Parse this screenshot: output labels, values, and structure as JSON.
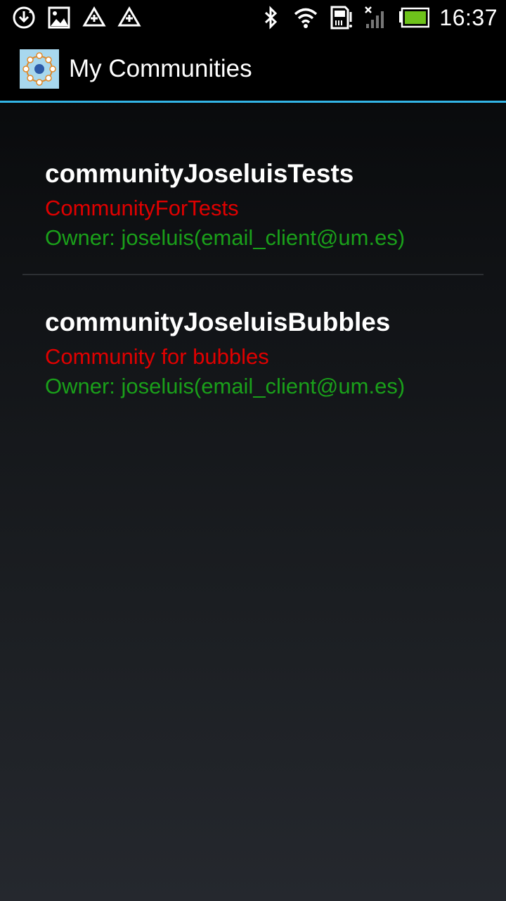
{
  "status_bar": {
    "time": "16:37",
    "left_icons": [
      "sync-download-icon",
      "gallery-icon",
      "recycle-icon",
      "recycle-icon"
    ],
    "right_icons": [
      "bluetooth-icon",
      "wifi-icon",
      "sd-card-alert-icon",
      "signal-off-icon",
      "battery-icon"
    ]
  },
  "action_bar": {
    "title": "My Communities",
    "accent_color": "#33b5e5"
  },
  "communities": [
    {
      "name": "communityJoseluisTests",
      "description": "CommunityForTests",
      "owner": "Owner: joseluis(email_client@um.es)"
    },
    {
      "name": "communityJoseluisBubbles",
      "description": "Community for bubbles",
      "owner": "Owner: joseluis(email_client@um.es)"
    }
  ],
  "colors": {
    "name": "#ffffff",
    "description": "#e00000",
    "owner": "#1aa01a"
  }
}
